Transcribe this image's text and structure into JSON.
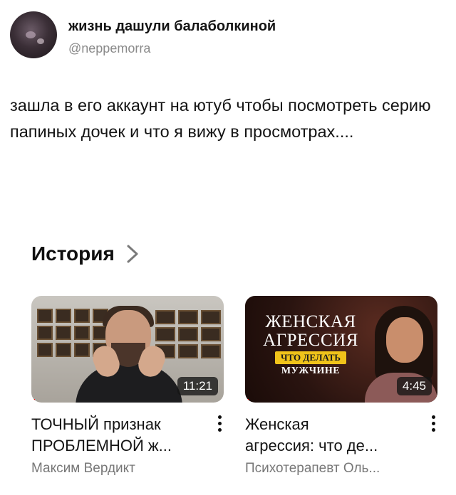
{
  "tweet": {
    "display_name": "жизнь дашули балаболкиной",
    "handle": "@neppemorra",
    "text": "зашла в его аккаунт на ютуб чтобы посмотреть серию папиных дочек и что я вижу в просмотрах...."
  },
  "history": {
    "title": "История",
    "chevron_icon": "chevron-right-icon",
    "videos": [
      {
        "title": "ТОЧНЫЙ признак\nПРОБЛЕМНОЙ ж...",
        "channel": "Максим Вердикт",
        "duration": "11:21",
        "progress": 0.02
      },
      {
        "title": "Женская\nагрессия: что де...",
        "channel": "Психотерапевт Оль...",
        "duration": "4:45",
        "progress": 0.02,
        "thumbnail_text": {
          "line1": "ЖЕНСКАЯ",
          "line2": "АГРЕССИЯ",
          "line3": "ЧТО ДЕЛАТЬ",
          "line4": "МУЖЧИНЕ"
        }
      }
    ]
  },
  "colors": {
    "progress_red": "#ff0000",
    "handle_gray": "#8a8a8a",
    "channel_gray": "#777777",
    "badge_yellow": "#f0c31a"
  }
}
